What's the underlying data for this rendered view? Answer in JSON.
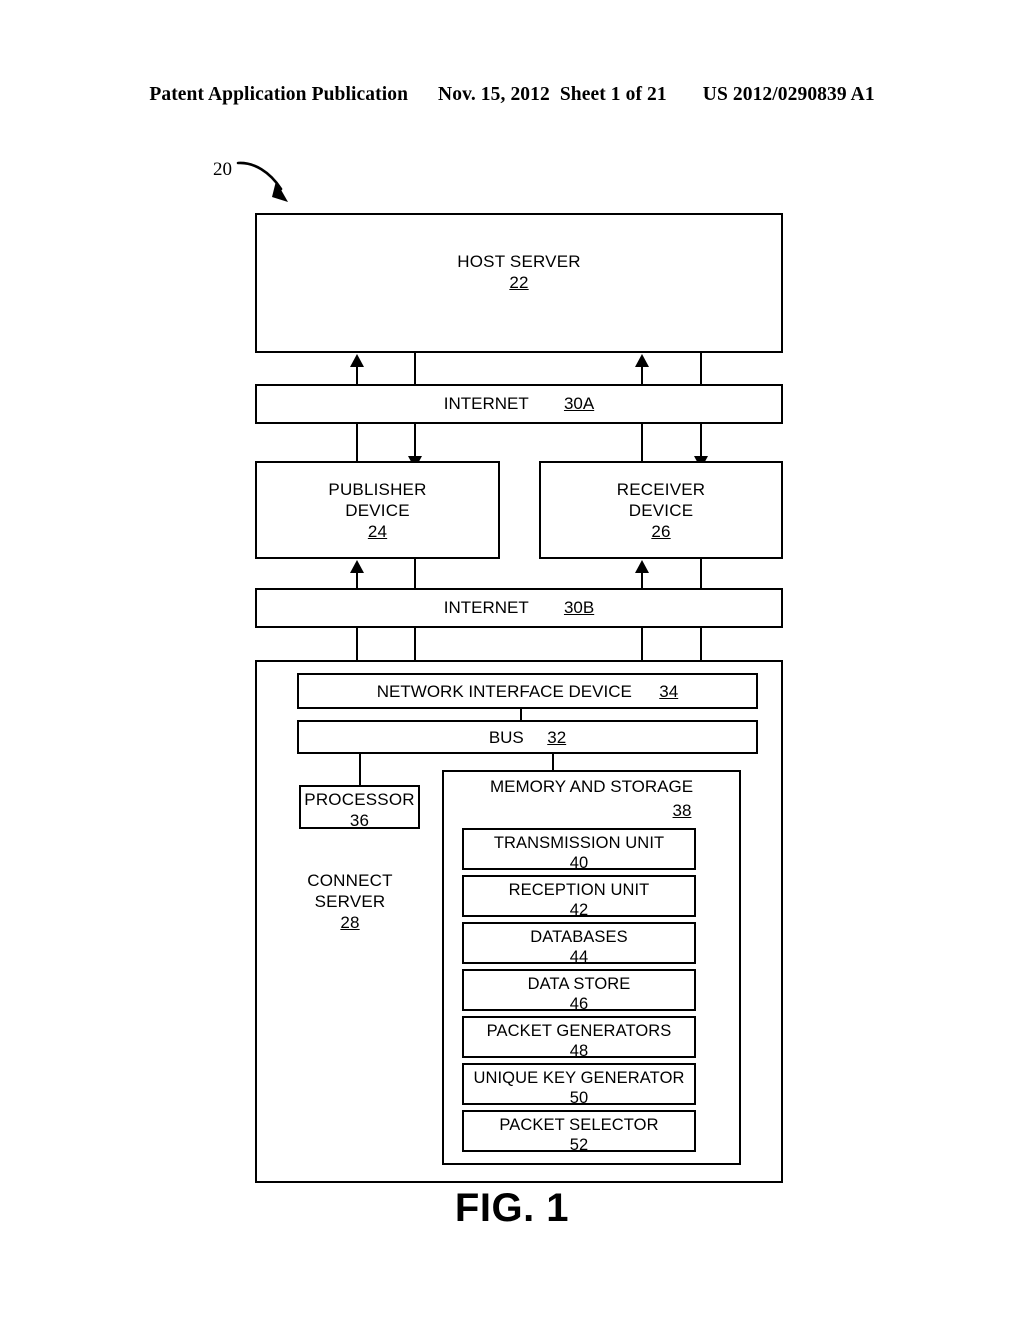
{
  "header": {
    "publication": "Patent Application Publication",
    "date": "Nov. 15, 2012",
    "sheet": "Sheet 1 of 21",
    "patent_number": "US 2012/0290839 A1"
  },
  "figure": {
    "caption": "FIG. 1",
    "system_callout": "20"
  },
  "nodes": {
    "host_server": {
      "title": "HOST SERVER",
      "ref": "22"
    },
    "internet_a": {
      "title": "INTERNET",
      "ref": "30A"
    },
    "publisher_device": {
      "line1": "PUBLISHER",
      "line2": "DEVICE",
      "ref": "24"
    },
    "receiver_device": {
      "line1": "RECEIVER",
      "line2": "DEVICE",
      "ref": "26"
    },
    "internet_b": {
      "title": "INTERNET",
      "ref": "30B"
    },
    "connect_server": {
      "line1": "CONNECT",
      "line2": "SERVER",
      "ref": "28"
    },
    "network_interface_device": {
      "title": "NETWORK INTERFACE DEVICE",
      "ref": "34"
    },
    "bus": {
      "title": "BUS",
      "ref": "32"
    },
    "processor": {
      "title": "PROCESSOR",
      "ref": "36"
    },
    "memory_and_storage": {
      "title": "MEMORY AND STORAGE",
      "ref": "38"
    }
  },
  "memory_modules": [
    {
      "title": "TRANSMISSION UNIT",
      "ref": "40"
    },
    {
      "title": "RECEPTION UNIT",
      "ref": "42"
    },
    {
      "title": "DATABASES",
      "ref": "44"
    },
    {
      "title": "DATA STORE",
      "ref": "46"
    },
    {
      "title": "PACKET GENERATORS",
      "ref": "48"
    },
    {
      "title": "UNIQUE KEY GENERATOR",
      "ref": "50"
    },
    {
      "title": "PACKET SELECTOR",
      "ref": "52"
    }
  ],
  "colors": {
    "ink": "#000000",
    "paper": "#ffffff"
  }
}
